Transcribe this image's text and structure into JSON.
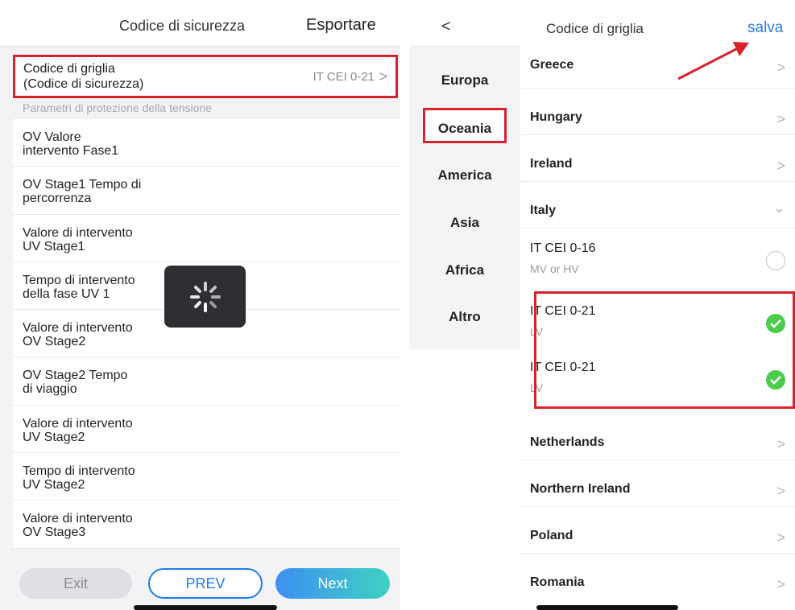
{
  "left_panel": {
    "header": {
      "title": "Codice di sicurezza",
      "export_label": "Esportare"
    },
    "grid_code_row": {
      "line1": "Codice di griglia",
      "line2": "(Codice di sicurezza)",
      "value": "IT CEI 0-21",
      "chevron": ">"
    },
    "section_title": "Parametri di protezione della tensione",
    "params": [
      {
        "line1": "OV Valore",
        "line2": "intervento Fase1"
      },
      {
        "line1": "OV Stage1 Tempo di",
        "line2": "percorrenza"
      },
      {
        "line1": "Valore di intervento",
        "line2": "UV Stage1"
      },
      {
        "line1": "Tempo di intervento",
        "line2": "della fase UV 1"
      },
      {
        "line1": "Valore di intervento",
        "line2": "OV Stage2"
      },
      {
        "line1": "OV Stage2 Tempo",
        "line2": "di viaggio"
      },
      {
        "line1": "Valore di intervento",
        "line2": "UV Stage2"
      },
      {
        "line1": "Tempo di intervento",
        "line2": "UV Stage2"
      },
      {
        "line1": "Valore di intervento",
        "line2": "OV Stage3"
      }
    ],
    "buttons": {
      "exit": "Exit",
      "prev": "PREV",
      "next": "Next"
    },
    "loading_icon": "spinner-icon"
  },
  "right_panel": {
    "header": {
      "back": "<",
      "title": "Codice di griglia",
      "save": "salva"
    },
    "continents": [
      {
        "label": "Europa"
      },
      {
        "label": "Oceania"
      },
      {
        "label": "America"
      },
      {
        "label": "Asia"
      },
      {
        "label": "Africa"
      },
      {
        "label": "Altro"
      }
    ],
    "selected_continent": "Europa",
    "countries_top": [
      {
        "name": "Greece",
        "arrow": ">"
      },
      {
        "name": "Hungary",
        "arrow": ">"
      },
      {
        "name": "Ireland",
        "arrow": ">"
      },
      {
        "name": "Italy",
        "arrow": "⌄"
      }
    ],
    "italy_codes": [
      {
        "code": "IT CEI 0-16",
        "voltage": "MV or HV",
        "selected": false
      },
      {
        "code": "IT CEI 0-21",
        "voltage": "LV",
        "selected": true
      },
      {
        "code": "IT CEI 0-21",
        "voltage": "LV",
        "selected": true
      }
    ],
    "countries_bottom": [
      {
        "name": "Netherlands",
        "arrow": ">"
      },
      {
        "name": "Northern Ireland",
        "arrow": ">"
      },
      {
        "name": "Poland",
        "arrow": ">"
      },
      {
        "name": "Romania",
        "arrow": ">"
      }
    ],
    "accent_colors": {
      "highlight_red": "#d8222b",
      "link_blue": "#2a7ce0",
      "check_green": "#4ccb4c"
    }
  }
}
